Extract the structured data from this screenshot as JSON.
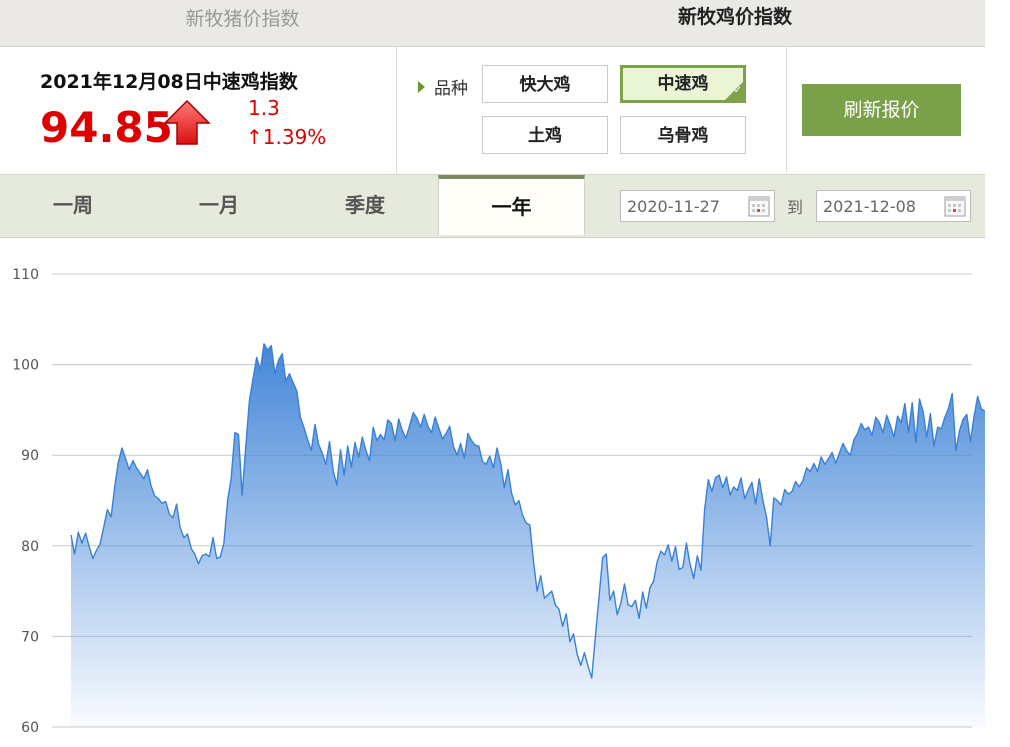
{
  "top_tabs": [
    "新牧猪价指数",
    "新牧鸡价指数"
  ],
  "index": {
    "title": "2021年12月08日中速鸡指数",
    "value": "94.85",
    "change": "1.3",
    "change_pct": "↑1.39%",
    "direction_icon": "up-arrow-icon"
  },
  "variety": {
    "label": "品种",
    "options": [
      "快大鸡",
      "中速鸡",
      "土鸡",
      "乌骨鸡"
    ],
    "selected": "中速鸡"
  },
  "refresh_label": "刷新报价",
  "range_tabs": [
    "一周",
    "一月",
    "季度",
    "一年"
  ],
  "range_selected": "一年",
  "date_from": "2020-11-27",
  "date_to_label": "到",
  "date_to": "2021-12-08",
  "colors": {
    "accent_green": "#7aa04a",
    "up_red": "#dd0000",
    "line_blue": "#3a80d6"
  },
  "chart_data": {
    "type": "area",
    "x": [
      "2020-11-27",
      "2021-12-08"
    ],
    "ylim": [
      60,
      110
    ],
    "yticks": [
      60,
      70,
      80,
      90,
      100,
      110
    ],
    "grid": true,
    "values": [
      81.2,
      79.1,
      81.5,
      80.3,
      81.4,
      79.9,
      78.6,
      79.5,
      80.2,
      82.1,
      84.0,
      83.2,
      86.5,
      89.2,
      90.8,
      89.6,
      88.4,
      89.4,
      88.6,
      88.0,
      87.4,
      88.4,
      86.6,
      85.5,
      85.2,
      84.7,
      84.9,
      83.5,
      83.1,
      84.6,
      82.0,
      80.9,
      81.3,
      79.7,
      79.1,
      78.0,
      78.9,
      79.1,
      78.8,
      80.9,
      78.6,
      78.8,
      80.3,
      85.0,
      87.5,
      92.5,
      92.3,
      85.6,
      91.0,
      96.0,
      98.5,
      100.8,
      99.4,
      102.3,
      101.6,
      102.1,
      99.0,
      100.5,
      101.2,
      98.2,
      99.0,
      98.0,
      97.1,
      94.2,
      93.0,
      91.7,
      90.5,
      93.4,
      91.2,
      90.2,
      89.0,
      91.5,
      88.3,
      86.7,
      90.6,
      87.8,
      91.0,
      88.7,
      91.4,
      89.8,
      92.0,
      90.5,
      89.4,
      93.1,
      91.6,
      92.3,
      91.7,
      93.9,
      93.5,
      91.6,
      94.0,
      92.7,
      91.9,
      93.3,
      94.7,
      94.1,
      93.1,
      94.5,
      93.2,
      92.5,
      94.2,
      93.0,
      91.8,
      92.4,
      93.2,
      91.0,
      90.0,
      91.3,
      89.7,
      92.4,
      91.6,
      91.1,
      91.0,
      89.3,
      89.0,
      89.9,
      88.6,
      90.8,
      89.1,
      86.4,
      88.4,
      85.8,
      84.5,
      85.0,
      83.4,
      82.5,
      82.3,
      78.3,
      75.0,
      76.7,
      74.2,
      74.6,
      75.0,
      73.5,
      73.0,
      71.1,
      72.5,
      69.4,
      70.3,
      68.0,
      66.8,
      68.2,
      66.7,
      65.4,
      70.0,
      74.3,
      78.7,
      79.1,
      74.0,
      75.0,
      72.4,
      73.7,
      75.8,
      73.5,
      73.3,
      74.0,
      72.0,
      74.9,
      73.1,
      75.4,
      76.1,
      78.3,
      79.4,
      79.0,
      80.1,
      78.3,
      79.9,
      77.4,
      77.6,
      80.3,
      78.0,
      76.4,
      78.9,
      77.3,
      84.0,
      87.3,
      86.0,
      87.5,
      87.8,
      86.4,
      87.6,
      85.6,
      86.5,
      86.1,
      87.5,
      85.2,
      86.2,
      87.0,
      84.6,
      87.4,
      85.0,
      83.2,
      80.0,
      85.3,
      85.0,
      84.5,
      86.2,
      85.7,
      86.0,
      87.1,
      86.5,
      87.2,
      88.6,
      88.2,
      89.1,
      88.2,
      89.8,
      89.0,
      89.6,
      90.3,
      89.1,
      90.2,
      91.3,
      90.5,
      90.0,
      91.7,
      92.4,
      93.5,
      92.8,
      93.1,
      92.2,
      94.2,
      93.6,
      92.5,
      94.4,
      93.3,
      92.0,
      94.3,
      93.6,
      95.7,
      92.5,
      95.8,
      91.4,
      96.2,
      94.8,
      92.0,
      94.6,
      91.0,
      93.1,
      92.9,
      94.2,
      95.2,
      96.8,
      90.5,
      92.7,
      94.0,
      94.5,
      91.5,
      94.3,
      96.5,
      95.1,
      94.85
    ]
  }
}
